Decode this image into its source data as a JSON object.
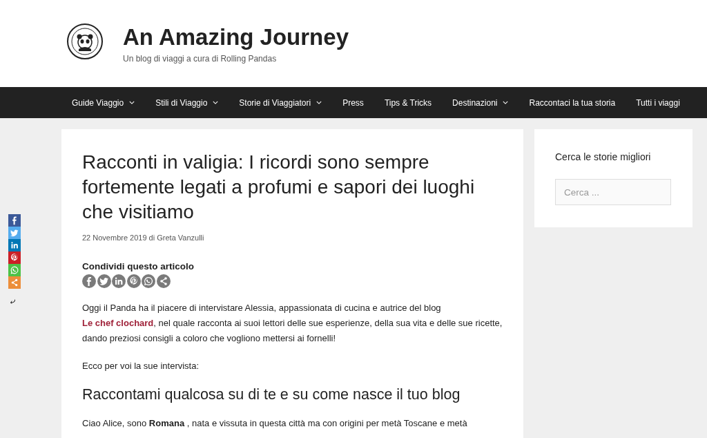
{
  "site": {
    "title": "An Amazing Journey",
    "tagline": "Un blog di viaggi a cura di Rolling Pandas"
  },
  "nav": [
    {
      "label": "Guide Viaggio",
      "dropdown": true
    },
    {
      "label": "Stili di Viaggio",
      "dropdown": true
    },
    {
      "label": "Storie di Viaggiatori",
      "dropdown": true
    },
    {
      "label": "Press",
      "dropdown": false
    },
    {
      "label": "Tips & Tricks",
      "dropdown": false
    },
    {
      "label": "Destinazioni",
      "dropdown": true
    },
    {
      "label": "Raccontaci la tua storia",
      "dropdown": false
    },
    {
      "label": "Tutti i viaggi",
      "dropdown": false
    }
  ],
  "floating_share": [
    {
      "kind": "facebook",
      "color": "#3b5998"
    },
    {
      "kind": "twitter",
      "color": "#55acee"
    },
    {
      "kind": "linkedin",
      "color": "#0077b5"
    },
    {
      "kind": "pinterest",
      "color": "#cb2027"
    },
    {
      "kind": "whatsapp",
      "color": "#4dc247"
    },
    {
      "kind": "share",
      "color": "#ec8e3a"
    }
  ],
  "article": {
    "title": "Racconti in valigia: I ricordi sono sempre fortemente legati a profumi e sapori dei luoghi che visitiamo",
    "date": "22 Novembre 2019",
    "by": "di",
    "author": "Greta Vanzulli",
    "share_heading": "Condividi questo articolo",
    "share_buttons": [
      {
        "kind": "facebook"
      },
      {
        "kind": "twitter"
      },
      {
        "kind": "linkedin"
      },
      {
        "kind": "pinterest"
      },
      {
        "kind": "whatsapp"
      },
      {
        "kind": "share"
      }
    ],
    "intro_before": "Oggi il Panda ha il piacere di intervistare Alessia, appassionata di cucina e autrice del blog ",
    "intro_link": "Le chef clochard",
    "intro_after": ", nel quale racconta ai suoi lettori delle sue esperienze, della sua vita e delle sue ricette, dando preziosi consigli a coloro che vogliono mettersi ai fornelli!",
    "lead": "Ecco per voi la sue intervista:",
    "heading": "Raccontami qualcosa su di te e su come nasce il tuo blog",
    "answer": "Ciao Alice, sono **Romana** , nata e vissuta in questa città ma con origini per metà Toscane e metà"
  },
  "sidebar": {
    "title": "Cerca le storie migliori",
    "search": {
      "placeholder": "Cerca ..."
    }
  }
}
